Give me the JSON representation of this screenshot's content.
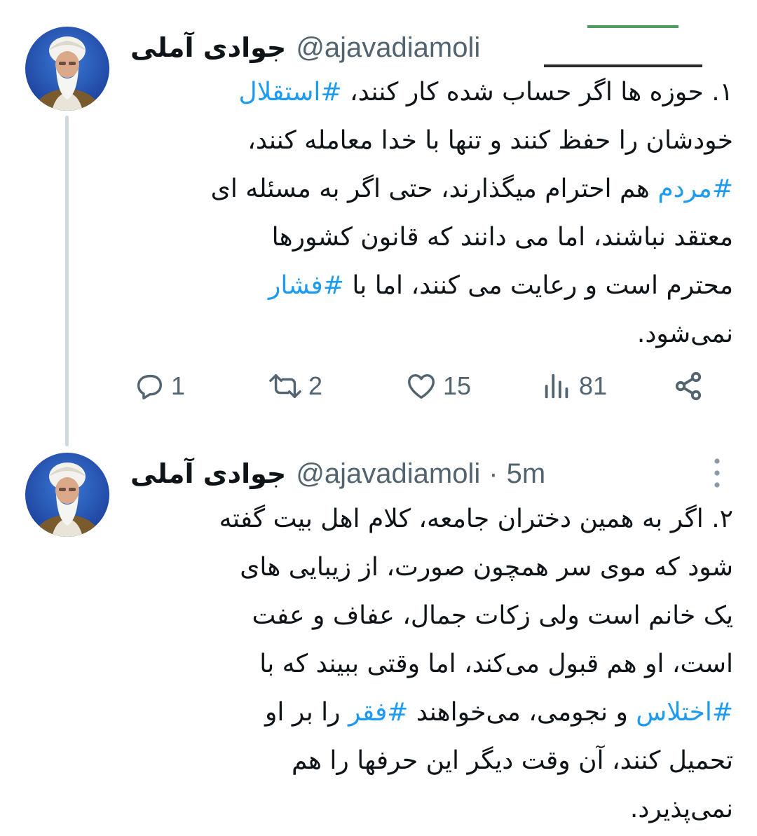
{
  "tweets": [
    {
      "display_name": "جوادی آملی",
      "handle": "@ajavadiamoli",
      "text_segments": [
        {
          "text": "۱. حوزه ها اگر حساب شده کار کنند، ",
          "hashtag": false
        },
        {
          "text": "#استقلال",
          "hashtag": true
        },
        {
          "text": "\nخودشان را حفظ کنند و تنها با خدا معامله کنند،\n",
          "hashtag": false
        },
        {
          "text": "#مردم",
          "hashtag": true
        },
        {
          "text": " هم احترام میگذارند، حتی اگر به مسئله ای\nمعتقد نباشند، اما می دانند که قانون کشورها\nمحترم است و رعایت می کنند، اما با ",
          "hashtag": false
        },
        {
          "text": "#فشار",
          "hashtag": true
        },
        {
          "text": "\nنمی‌شود.",
          "hashtag": false
        }
      ],
      "actions": {
        "replies": "1",
        "retweets": "2",
        "likes": "15",
        "views": "81"
      }
    },
    {
      "display_name": "جوادی آملی",
      "handle": "@ajavadiamoli",
      "separator": "·",
      "time": "5m",
      "text_segments": [
        {
          "text": "۲. اگر به همین دختران جامعه، کلام اهل بیت گفته\nشود که موی سر همچون صورت، از زیبایی های\nیک خانم است ولی زکات جمال، عفاف و عفت\nاست، او هم قبول می‌کند، اما وقتی ببیند که با\n",
          "hashtag": false
        },
        {
          "text": "#اختلاس",
          "hashtag": true
        },
        {
          "text": " و نجومی، می‌خواهند ",
          "hashtag": false
        },
        {
          "text": "#فقر",
          "hashtag": true
        },
        {
          "text": " را بر او\nتحمیل کنند، آن وقت دیگر این حرفها را هم\nنمی‌پذیرد.",
          "hashtag": false
        }
      ]
    }
  ],
  "colors": {
    "text": "#0f1419",
    "secondary": "#536471",
    "hashtag": "#1d9bf0",
    "thread_line": "#cfd9de"
  },
  "icons": [
    "reply-icon",
    "retweet-icon",
    "like-icon",
    "views-icon",
    "share-icon",
    "more-icon"
  ]
}
